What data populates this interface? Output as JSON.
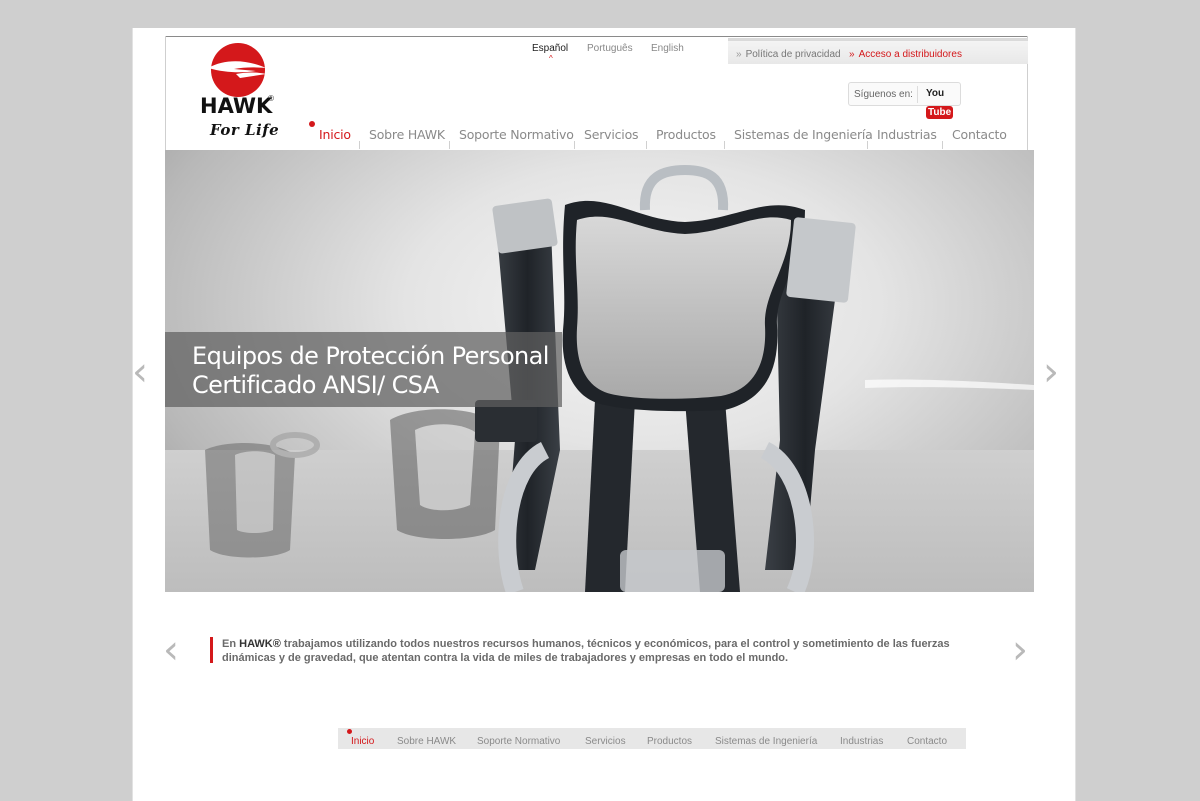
{
  "logo": {
    "wordmark": "HAWK",
    "registered": "®",
    "tagline": "For Life"
  },
  "languages": [
    {
      "label": "Español",
      "active": true
    },
    {
      "label": "Português",
      "active": false
    },
    {
      "label": "English",
      "active": false
    }
  ],
  "utility_links": [
    {
      "chevron": "»",
      "label": "Política de privacidad"
    },
    {
      "chevron": "»",
      "label": "Acceso a distribuidores"
    }
  ],
  "social": {
    "label": "Síguenos en:",
    "youtube_you": "You",
    "youtube_tube": "Tube"
  },
  "nav": {
    "items": [
      "Inicio",
      "Sobre HAWK",
      "Soporte Normativo",
      "Servicios",
      "Productos",
      "Sistemas de Ingeniería",
      "Industrias",
      "Contacto"
    ],
    "active_index": 0
  },
  "hero": {
    "caption_line1": "Equipos de Protección Personal",
    "caption_line2": "Certificado ANSI/ CSA",
    "prev_arrow": "‹",
    "next_arrow": "›",
    "image_icon": "safety-harness-photo"
  },
  "intro": {
    "prefix": "En ",
    "brand": "HAWK®",
    "text": " trabajamos utilizando todos nuestros recursos humanos, técnicos y económicos, para el control y sometimiento de las fuerzas dinámicas y de gravedad, que atentan contra la vida de miles de trabajadores y empresas en todo el mundo.",
    "prev_arrow": "‹",
    "next_arrow": "›"
  },
  "footer_nav": {
    "items": [
      "Inicio",
      "Sobre HAWK",
      "Soporte Normativo",
      "Servicios",
      "Productos",
      "Sistemas de Ingeniería",
      "Industrias",
      "Contacto"
    ],
    "active_index": 0
  },
  "colors": {
    "accent": "#d4181b",
    "text_gray": "#8a8a8a",
    "background": "#cfcfcf"
  }
}
